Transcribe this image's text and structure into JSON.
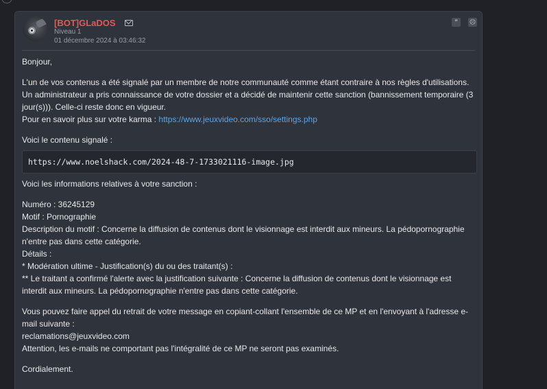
{
  "post": {
    "author": "[BOT]GLaDOS",
    "level": "Niveau 1",
    "date": "01 décembre 2024 à 03:46:32",
    "icons": {
      "mail": "mail-icon",
      "quote": "quote-icon",
      "report": "report-icon"
    },
    "quote_glyph": "”",
    "report_glyph": "☹",
    "colors": {
      "author": "#e05a5a",
      "link": "#5aa6ea",
      "background": "#2f333b"
    }
  },
  "message": {
    "greeting": "Bonjour,",
    "p1_l1": "L'un de vos contenus a été signalé par un membre de notre communauté comme étant contraire à nos règles d'utilisations.",
    "p1_l2": "Un administrateur a pris connaissance de votre dossier et a décidé de maintenir cette sanction (bannissement temporaire (3",
    "p1_l3": "jour(s))). Celle-ci reste donc en vigueur.",
    "p1_l4_prefix": "Pour en savoir plus sur votre karma : ",
    "karma_link": "https://www.jeuxvideo.com/sso/settings.php",
    "reported_intro": "Voici le contenu signalé :",
    "reported_url": "https://www.noelshack.com/2024-48-7-1733021116-image.jpg",
    "sanction_intro": "Voici les informations relatives à votre sanction :",
    "numero": "Numéro : 36245129",
    "motif": "Motif : Pornographie",
    "desc_l1": "Description du motif : Concerne la diffusion de contenus dont le visionnage est interdit aux mineurs. La pédopornographie",
    "desc_l2": "n'entre pas dans cette catégorie.",
    "details": "Détails :",
    "moderation": "* Modération ultime - Justification(s) du ou des traitant(s) :",
    "traitant_l1": "** Le traitant a confirmé l'alerte avec la justification suivante : Concerne la diffusion de contenus dont le visionnage est",
    "traitant_l2": "interdit aux mineurs. La pédopornographie n'entre pas dans cette catégorie.",
    "appeal_l1": "Vous pouvez faire appel du retrait de votre message en copiant-collant l'ensemble de ce MP et en l'envoyant à l'adresse e-",
    "appeal_l2": "mail suivante :",
    "appeal_email": "reclamations@jeuxvideo.com",
    "appeal_warning": "Attention, les e-mails ne comportant pas l'intégralité de ce MP ne seront pas examinés.",
    "closing": "Cordialement."
  }
}
